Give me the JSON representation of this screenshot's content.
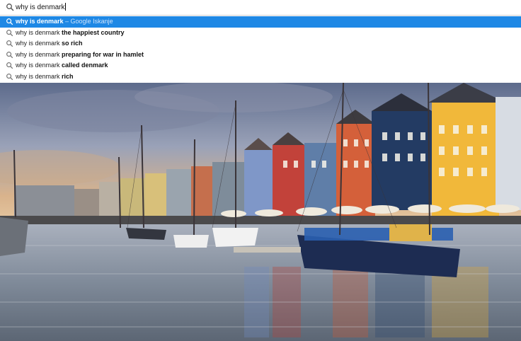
{
  "omnibox": {
    "query_text": "why is denmark",
    "icon": "search-icon"
  },
  "suggestions": [
    {
      "prefix": "why is denmark",
      "bold": "",
      "separator": " – ",
      "secondary": "Google Iskanje",
      "selected": true
    },
    {
      "prefix": "why is denmark ",
      "bold": "the happiest country",
      "separator": "",
      "secondary": "",
      "selected": false
    },
    {
      "prefix": "why is denmark ",
      "bold": "so rich",
      "separator": "",
      "secondary": "",
      "selected": false
    },
    {
      "prefix": "why is denmark ",
      "bold": "preparing for war in hamlet",
      "separator": "",
      "secondary": "",
      "selected": false
    },
    {
      "prefix": "why is denmark ",
      "bold": "called denmark",
      "separator": "",
      "secondary": "",
      "selected": false
    },
    {
      "prefix": "why is denmark ",
      "bold": "rich",
      "separator": "",
      "secondary": "",
      "selected": false
    }
  ],
  "colors": {
    "selected_row": "#1e88e5",
    "sky_top": "#6f7fa0",
    "water": "#8c97a6"
  }
}
